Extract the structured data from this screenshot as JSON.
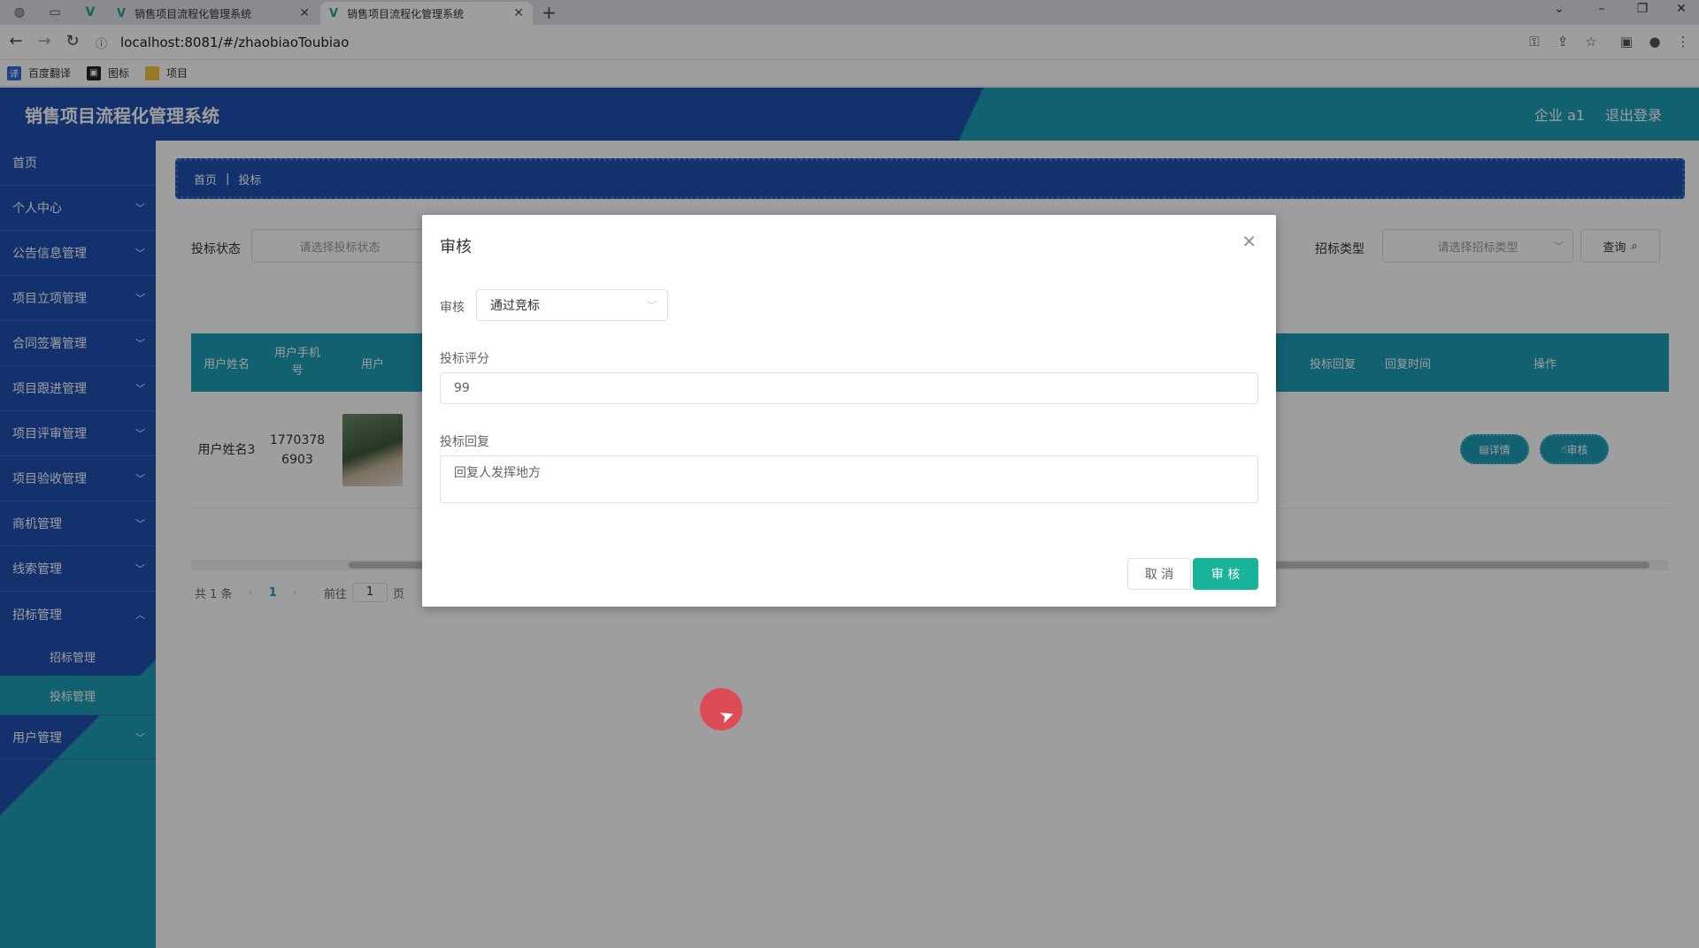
{
  "browser": {
    "tabs": [
      {
        "title": "销售项目流程化管理系统",
        "active": false
      },
      {
        "title": "销售项目流程化管理系统",
        "active": true
      }
    ],
    "url": "localhost:8081/#/zhaobiaoToubiao",
    "bookmarks": [
      "百度翻译",
      "图标",
      "项目"
    ]
  },
  "header": {
    "title": "销售项目流程化管理系统",
    "user": "企业 a1",
    "logout": "退出登录"
  },
  "sidebar": {
    "items": [
      {
        "label": "首页",
        "has_children": false
      },
      {
        "label": "个人中心",
        "has_children": true
      },
      {
        "label": "公告信息管理",
        "has_children": true
      },
      {
        "label": "项目立项管理",
        "has_children": true
      },
      {
        "label": "合同签署管理",
        "has_children": true
      },
      {
        "label": "项目跟进管理",
        "has_children": true
      },
      {
        "label": "项目评审管理",
        "has_children": true
      },
      {
        "label": "项目验收管理",
        "has_children": true
      },
      {
        "label": "商机管理",
        "has_children": true
      },
      {
        "label": "线索管理",
        "has_children": true
      },
      {
        "label": "招标管理",
        "has_children": true
      }
    ],
    "submenu": [
      {
        "label": "招标管理",
        "active": false
      },
      {
        "label": "投标管理",
        "active": true
      }
    ],
    "last_item": {
      "label": "用户管理"
    }
  },
  "breadcrumb": {
    "home": "首页",
    "current": "投标"
  },
  "filters": {
    "status_label": "投标状态",
    "status_placeholder": "请选择投标状态",
    "type_label": "招标类型",
    "type_placeholder": "请选择招标类型",
    "query_label": "查询"
  },
  "table": {
    "headers_left": [
      "用户姓名",
      "用户手机号",
      "用户"
    ],
    "headers_right": [
      "投标回复",
      "回复时间",
      "操作"
    ],
    "row": {
      "name": "用户姓名3",
      "phone": "17703786903"
    },
    "actions": {
      "detail": "详情",
      "audit": "审核"
    }
  },
  "pager": {
    "total": "共 1 条",
    "page": "1",
    "goto": "前往",
    "page_unit": "页",
    "goto_value": "1"
  },
  "dialog": {
    "title": "审核",
    "audit_label": "审核",
    "audit_value": "通过竞标",
    "score_label": "投标评分",
    "score_value": "99",
    "reply_label": "投标回复",
    "reply_value": "回复人发挥地方",
    "cancel": "取 消",
    "ok": "审 核"
  }
}
